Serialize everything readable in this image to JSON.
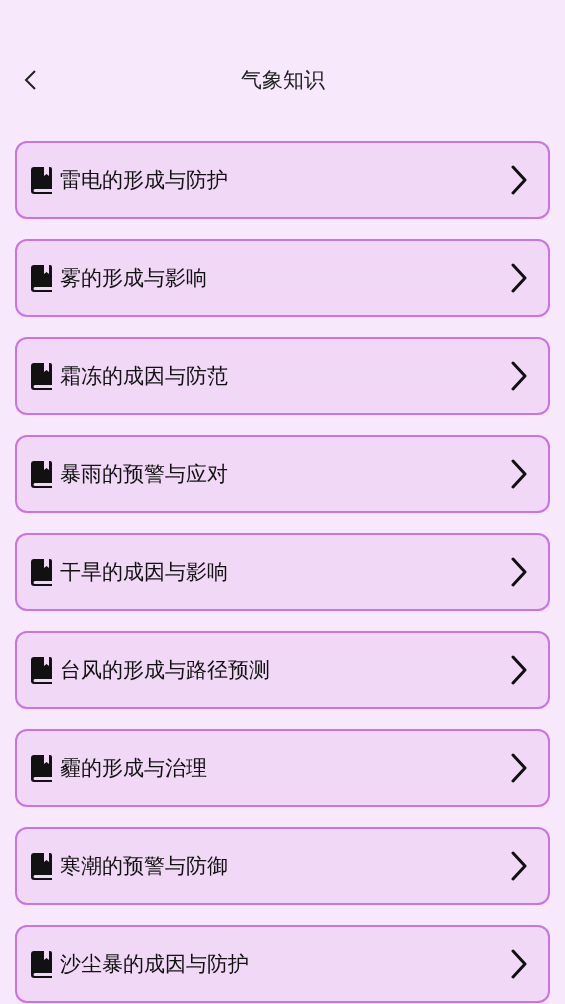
{
  "header": {
    "title": "气象知识"
  },
  "items": [
    {
      "label": "雷电的形成与防护"
    },
    {
      "label": "雾的形成与影响"
    },
    {
      "label": "霜冻的成因与防范"
    },
    {
      "label": "暴雨的预警与应对"
    },
    {
      "label": "干旱的成因与影响"
    },
    {
      "label": "台风的形成与路径预测"
    },
    {
      "label": "霾的形成与治理"
    },
    {
      "label": "寒潮的预警与防御"
    },
    {
      "label": "沙尘暴的成因与防护"
    }
  ]
}
